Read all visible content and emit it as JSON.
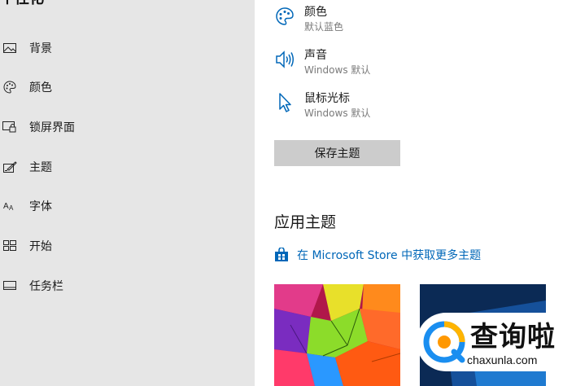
{
  "sidebar": {
    "title": "个性化",
    "items": [
      {
        "label": "背景",
        "icon": "picture-icon"
      },
      {
        "label": "颜色",
        "icon": "palette-icon"
      },
      {
        "label": "锁屏界面",
        "icon": "lock-screen-icon"
      },
      {
        "label": "主题",
        "icon": "theme-icon"
      },
      {
        "label": "字体",
        "icon": "font-icon"
      },
      {
        "label": "开始",
        "icon": "start-icon"
      },
      {
        "label": "任务栏",
        "icon": "taskbar-icon"
      }
    ]
  },
  "main": {
    "items": [
      {
        "title": "颜色",
        "subtitle": "默认蓝色",
        "icon": "palette-icon"
      },
      {
        "title": "声音",
        "subtitle": "Windows 默认",
        "icon": "speaker-icon"
      },
      {
        "title": "鼠标光标",
        "subtitle": "Windows 默认",
        "icon": "cursor-icon"
      }
    ],
    "save_button": "保存主题",
    "section_title": "应用主题",
    "store_link": "在 Microsoft Store 中获取更多主题"
  },
  "watermark": {
    "text": "查询啦",
    "sub": "chaxunla.com"
  },
  "colors": {
    "sidebar_bg": "#e6e6e6",
    "accent": "#0067b8",
    "button_bg": "#cccccc"
  }
}
